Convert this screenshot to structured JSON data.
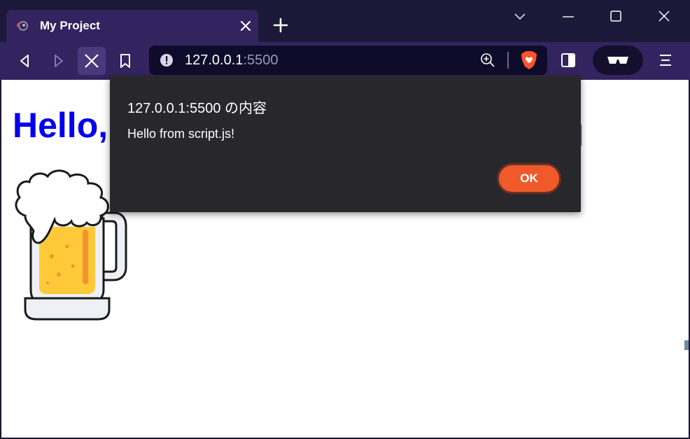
{
  "window": {
    "controls": [
      "tab-search",
      "minimize",
      "maximize",
      "close"
    ]
  },
  "tab": {
    "title": "My Project",
    "favicon": "loading-globe-icon"
  },
  "toolbar": {
    "url_host": "127.0.0.1",
    "url_port": ":5500",
    "icons": [
      "back-icon",
      "forward-icon",
      "stop-icon",
      "bookmark-icon",
      "info-icon",
      "zoom-icon",
      "brave-shields-icon",
      "sidebar-icon",
      "private-glasses-icon",
      "menu-icon"
    ]
  },
  "page": {
    "heading": "Hello,",
    "image": "beer-mug-image"
  },
  "dialog": {
    "title": "127.0.0.1:5500 の内容",
    "message": "Hello from script.js!",
    "ok_label": "OK"
  },
  "colors": {
    "titlebar": "#1c1838",
    "toolbar": "#332460",
    "urlbar": "#0f0b2a",
    "heading": "#0000ee",
    "dialog_bg": "#28272c",
    "ok_button": "#f05a2a"
  }
}
